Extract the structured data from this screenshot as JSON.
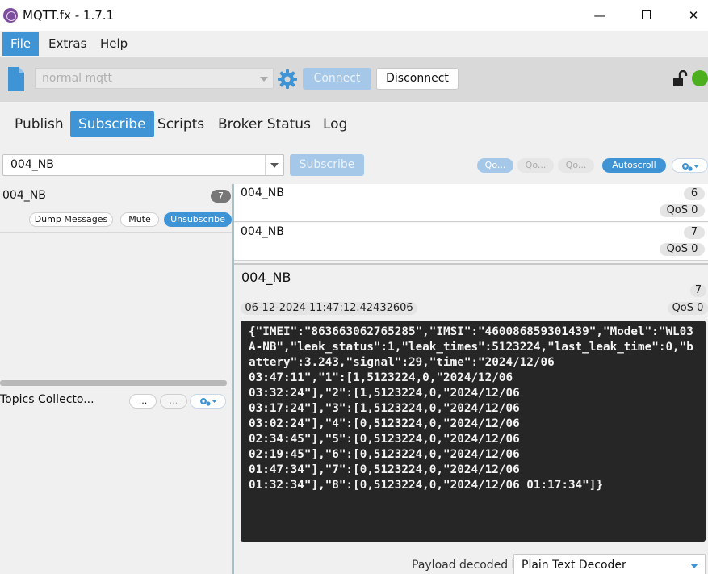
{
  "window": {
    "title": "MQTT.fx - 1.7.1",
    "minimize": "—",
    "close": "✕"
  },
  "menu": {
    "items": [
      "File",
      "Extras",
      "Help"
    ]
  },
  "connection": {
    "profile": "normal mqtt",
    "connect_label": "Connect",
    "disconnect_label": "Disconnect",
    "status_color": "#4caf1e"
  },
  "tabs": [
    "Publish",
    "Subscribe",
    "Scripts",
    "Broker Status",
    "Log"
  ],
  "subscribe_bar": {
    "topic": "004_NB",
    "subscribe_label": "Subscribe",
    "qos0": "Qo...",
    "qos1": "Qo...",
    "qos2": "Qo...",
    "autoscroll": "Autoscroll"
  },
  "subscriptions": [
    {
      "topic": "004_NB",
      "count": "7",
      "dump": "Dump Messages",
      "mute": "Mute",
      "unsubscribe": "Unsubscribe"
    }
  ],
  "topics_collector": {
    "label": "Topics Collecto...",
    "btn1": "...",
    "btn2": "..."
  },
  "messages": [
    {
      "topic": "004_NB",
      "num": "6",
      "qos": "QoS 0"
    },
    {
      "topic": "004_NB",
      "num": "7",
      "qos": "QoS 0"
    }
  ],
  "detail": {
    "topic": "004_NB",
    "num": "7",
    "timestamp": "06-12-2024  11:47:12.42432606",
    "qos": "QoS 0",
    "payload": "{\"IMEI\":\"863663062765285\",\"IMSI\":\"460086859301439\",\"Model\":\"WL03A-NB\",\"leak_status\":1,\"leak_times\":5123224,\"last_leak_time\":0,\"battery\":3.243,\"signal\":29,\"time\":\"2024/12/06\n03:47:11\",\"1\":[1,5123224,0,\"2024/12/06\n03:32:24\"],\"2\":[1,5123224,0,\"2024/12/06\n03:17:24\"],\"3\":[1,5123224,0,\"2024/12/06\n03:02:24\"],\"4\":[0,5123224,0,\"2024/12/06\n02:34:45\"],\"5\":[0,5123224,0,\"2024/12/06\n02:19:45\"],\"6\":[0,5123224,0,\"2024/12/06\n01:47:34\"],\"7\":[0,5123224,0,\"2024/12/06\n01:32:34\"],\"8\":[0,5123224,0,\"2024/12/06 01:17:34\"]}",
    "decoder_label": "Payload decoded by",
    "decoder": "Plain Text Decoder"
  }
}
